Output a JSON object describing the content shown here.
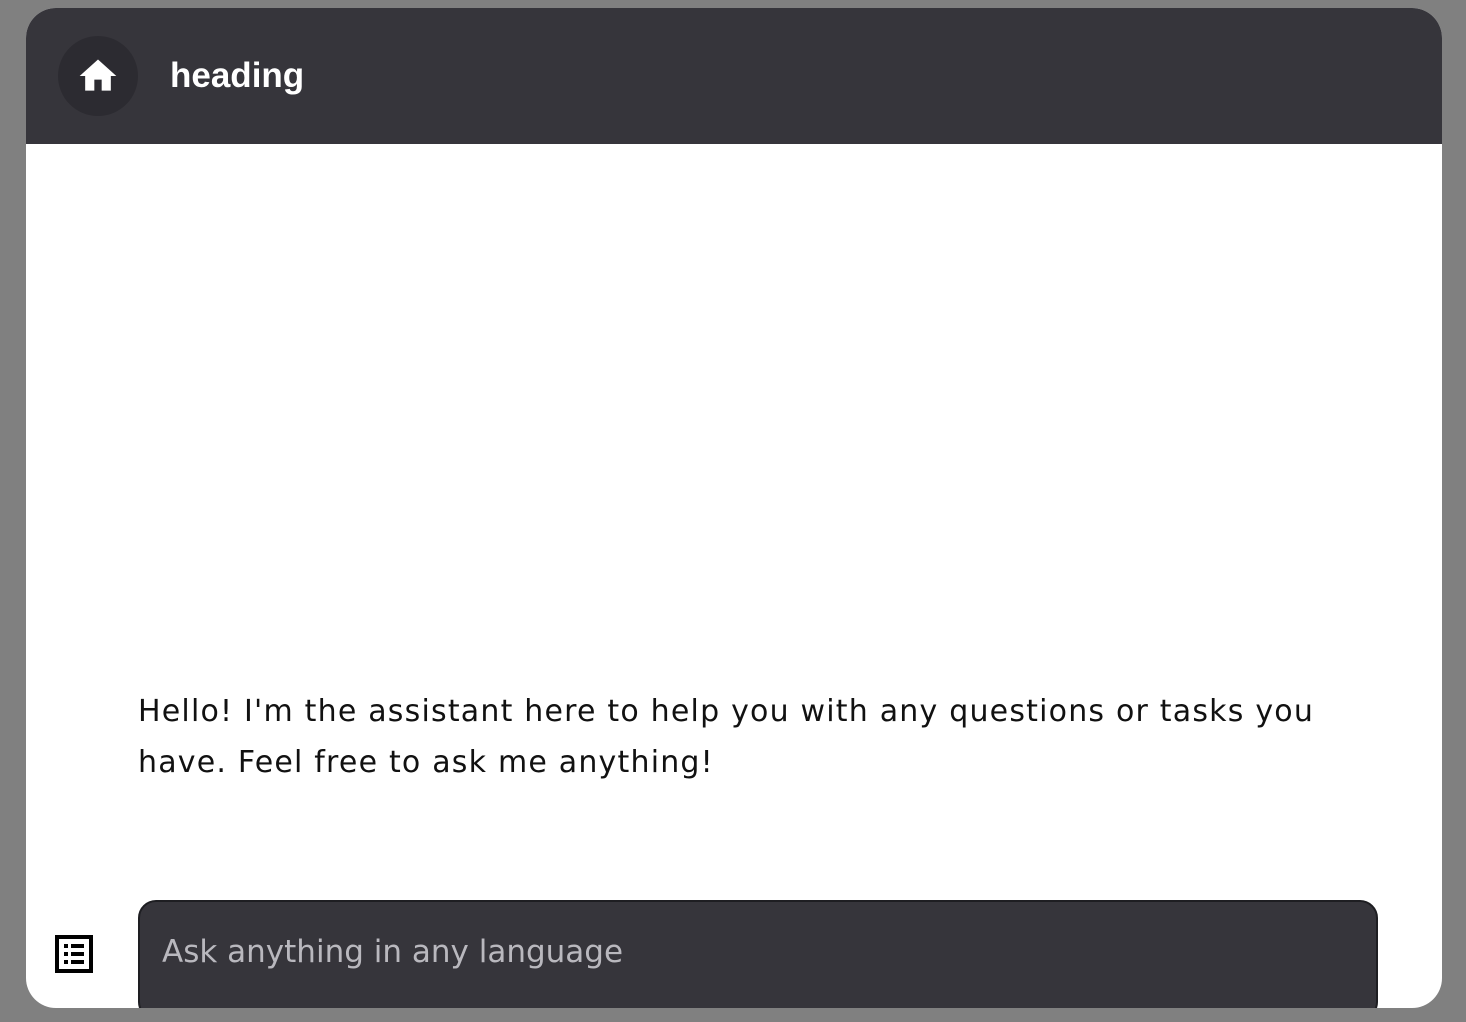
{
  "header": {
    "title": "heading",
    "home_icon": "home-icon",
    "background_color": "#36353b"
  },
  "chat": {
    "messages": [
      {
        "role": "assistant",
        "text": "Hello! I'm the assistant here to help you with any questions or tasks you have. Feel free to ask me anything!"
      }
    ]
  },
  "composer": {
    "placeholder": "Ask anything in any language",
    "value": "",
    "menu_icon": "list-icon"
  }
}
